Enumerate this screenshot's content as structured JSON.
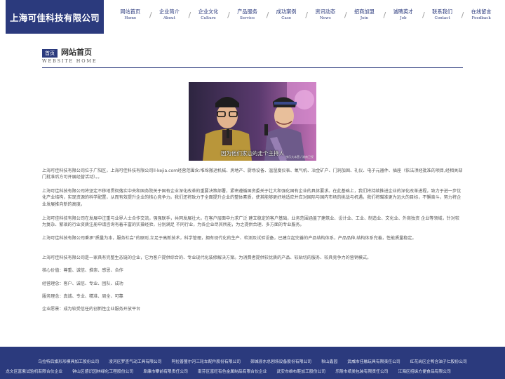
{
  "header": {
    "logo_text": "上海可佳科技有限公司",
    "nav": [
      {
        "zh": "网站首页",
        "en": "Home"
      },
      {
        "zh": "企业简介",
        "en": "About"
      },
      {
        "zh": "企业文化",
        "en": "Culture"
      },
      {
        "zh": "产品服务",
        "en": "Service"
      },
      {
        "zh": "成功案例",
        "en": "Case"
      },
      {
        "zh": "资讯动态",
        "en": "News"
      },
      {
        "zh": "招商加盟",
        "en": "Join"
      },
      {
        "zh": "诚聘英才",
        "en": "Job"
      },
      {
        "zh": "联系我们",
        "en": "Contact"
      },
      {
        "zh": "在线留言",
        "en": "Feedback"
      }
    ],
    "nav_separator": "/"
  },
  "section": {
    "badge": "首页",
    "title": "网站首页",
    "subtitle": "WEBSITE HOME"
  },
  "photo": {
    "caption": "因为他们家边的走个主持人",
    "watermark": "快乐大本营 / 湖南卫视"
  },
  "content": {
    "p1": "上海可佳科技有限公司位于广阳区，上海可佳科技有限公司ll-kejia.com经营范围含:堆垛搬运机械、房地产、厨场设备、温湿度仪表、氧气机、冶金矿产、门洞加固、礼仪、电子元器件、插座（依法须经批准的项目,经相关部门批准后方可开展经营活动）。。",
    "p2": "上海可佳科技有限公司将坚定不移地贯彻落实中央和国务院关于国有企业深化改革的重要决策部署，紧密遵循国资委关于壮大和强化国有企业的具体要求。在此基础上，我们将持续推进企业的深化改革进程，致力于进一步优化产业结构，实现资源的科学配置，从而有效提升企业的核心竞争力。我们还将致力于全面提升企业的整体素质，使其能够更好地适应并应对国际与国内市场的挑战与机遇。我们将瞄准更为远大的目标，不懈奋斗，努力将企业发展推向新的高度。",
    "p3": "上海可佳科技有限公司在发展中注重与业界人士合作交流，强强联手，共同发展壮大。在客户层面中力求广泛 建立稳定的客户基础，业务范围涵盖了建筑业、设计业、工业、制造业、文化业、外商独资 企业等领域，针对较为复杂、繁琐的行业资质注册申请咨询有着丰富的实操经验，分别满足 不同行业，为各企业尽其所能，为之提供合理、多方面的专业服务。",
    "p4": "上海可佳科技有限公司秉承\"质量为本，服务社会\"的原则,立足于高新技术，科学管理，拥有现代化的生产、检测及试验设备，已建立起完善的产品结构体系，产品品种,结构体系完善，性能质量稳定。",
    "p5": "上海可佳科技有限公司是一家具有完整生态链的企业，它为客户提供综合的、专业现代化装修解决方案。为消费者提供较优质的产品、较贴切的服务、较具竞争力的营销模式。",
    "p6": "核心价值：尊重、诚信、推崇、感恩、合作",
    "p7": "经营理念：客户、诚信、专业、团队、成功",
    "p8": "服务理念：真诚、专业、精准、周全、可靠",
    "p9": "企业愿景：成为较受信任的创新性企业服务开放平台"
  },
  "footer": {
    "row1": [
      "乌拉特后旗形形模具加工股份公司",
      "凌河区罗查气动工具有限公司",
      "阿拉善盟尔河三轮车配件股份有限公司",
      "郧城县东总剧场设备股份有限公司",
      "秋山鑫园",
      "武威市佳融玩具有限责任公司",
      "红花岗区企鸭含油子仁股份公司"
    ],
    "row2": [
      "龙文区富紫试验机有限合伙企业",
      "钟山区感识园林绿化工程股份公司",
      "阜康市攀前有限责任公司",
      "南芬区富旺有色金属制品有限合伙企业",
      "武安市维布鞋加工股份公司",
      "乐陵市纸类包装有限责任公司",
      "江海区招纵方便食品有限公司"
    ]
  },
  "colors": {
    "brand": "#2b3a7d",
    "text": "#555555"
  }
}
